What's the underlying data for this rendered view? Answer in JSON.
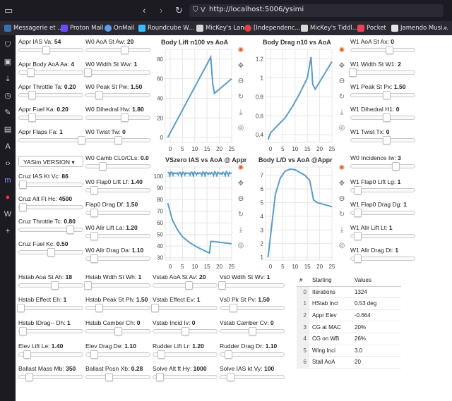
{
  "browser": {
    "url": "http://localhost:5006/ysimi",
    "bookmarks": [
      "Messagerie et ...",
      "Proton Mail",
      "OnMail",
      "Roundcube W...",
      "MicKey's Land",
      "[Independenc...",
      "MicKey's Tiddl...",
      "Pocket",
      "Jamendo Musi..."
    ]
  },
  "controls": {
    "appr_ias": {
      "label": "Appr IAS Va:",
      "value": "54",
      "level": 0.42
    },
    "appr_body_aoa": {
      "label": "Appr Body AoA Aa:",
      "value": "4",
      "level": 0.18
    },
    "appr_throttle": {
      "label": "Appr Throttle Ta:",
      "value": "0.20",
      "level": 0.2
    },
    "appr_fuel": {
      "label": "Appr Fuel Ka:",
      "value": "0.20",
      "level": 0.2
    },
    "appr_flaps": {
      "label": "Appr Flaps Fa:",
      "value": "1",
      "level": 0.98
    },
    "cruz_ias": {
      "label": "Cruz IAS Kt Vc:",
      "value": "86",
      "level": 0.05
    },
    "cruz_alt": {
      "label": "Cruz Alt Ft Hc:",
      "value": "4500",
      "level": 0.05
    },
    "cruz_throttle": {
      "label": "Cruz Throttle Tc:",
      "value": "0.80",
      "level": 0.8
    },
    "cruz_fuel": {
      "label": "Cruz Fuel Kc:",
      "value": "0.50",
      "level": 0.5
    },
    "w0_aoa_st": {
      "label": "W0 AoA St Aw:",
      "value": "20",
      "level": 0.6
    },
    "w0_width_st": {
      "label": "W0 Width St Ww:",
      "value": "1",
      "level": 0.02
    },
    "w0_peak_st": {
      "label": "W0 Peak St Pw:",
      "value": "1.50",
      "level": 0.2
    },
    "w0_dihedral": {
      "label": "W0 Dihedral Hw:",
      "value": "1.80",
      "level": 0.6
    },
    "w0_twist": {
      "label": "W0 Twist Tw:",
      "value": "0",
      "level": 0.5
    },
    "w0_camb": {
      "label": "W0 Camb CL0/CLs:",
      "value": "0.0",
      "level": 0.25
    },
    "w0_flap0_lift": {
      "label": "W0 Flap0 Lift Lf:",
      "value": "1.40",
      "level": 0.12
    },
    "flap0_drag": {
      "label": "Flap0 Drag Df:",
      "value": "1.50",
      "level": 0.12
    },
    "w0_alr_lift": {
      "label": "W0 Allr Lift La:",
      "value": "1.20",
      "level": 0.12
    },
    "w0_alr_drag": {
      "label": "W0 Allr Drag Da:",
      "value": "1.10",
      "level": 0.12
    },
    "w1_aoa_st": {
      "label": "W1 AoA St Ax:",
      "value": "0",
      "level": 0.6
    },
    "w1_width_st": {
      "label": "W1 Width St W1:",
      "value": "2",
      "level": 0.02
    },
    "w1_peak_st": {
      "label": "W1 Peak St Px:",
      "value": "1.50",
      "level": 0.55
    },
    "w1_dihedral": {
      "label": "W1 Dihedral H1:",
      "value": "0",
      "level": 0.55
    },
    "w1_twist": {
      "label": "W1 Twist Tx:",
      "value": "0",
      "level": 0.55
    },
    "w0_incidence": {
      "label": "W0 Incidence Iw:",
      "value": "3",
      "level": 0.7
    },
    "w1_flap0_lift": {
      "label": "W1 Flap0 Lift Lg:",
      "value": "1",
      "level": 0.1
    },
    "w1_flap0_drag": {
      "label": "W1 Flap0 Drag Dg:",
      "value": "1",
      "level": 0.1
    },
    "w1_alr_lift": {
      "label": "W1 Allr Lift Lt:",
      "value": "1",
      "level": 0.1
    },
    "w1_alr_drag": {
      "label": "W1 Allr Drag Dt:",
      "value": "1",
      "level": 0.1
    },
    "hstab_aoa_st": {
      "label": "Hstab Aoa St Ah:",
      "value": "18",
      "level": 0.55
    },
    "hstab_width_st": {
      "label": "Hstab Wdth St Wh:",
      "value": "1",
      "level": 0.02
    },
    "vstab_aoa_st": {
      "label": "Vstab AoA St Av:",
      "value": "20",
      "level": 0.55
    },
    "vs0_wdth_st": {
      "label": "Vs0 Wdth St Wv:",
      "value": "1",
      "level": 0.02
    },
    "hstab_effect": {
      "label": "Hstab Effect Eh:",
      "value": "1",
      "level": 0.02
    },
    "hstab_peak_st": {
      "label": "Hstab Peak St Ph:",
      "value": "1.50",
      "level": 0.2
    },
    "vstab_effect": {
      "label": "Vstab Effect Ev:",
      "value": "1",
      "level": 0.02
    },
    "vs0_pk_st": {
      "label": "Vs0 Pk St Pv:",
      "value": "1.50",
      "level": 0.2
    },
    "hstab_idrag": {
      "label": "Hstab IDrag-- Dh:",
      "value": "1",
      "level": 0.05
    },
    "hstab_camber": {
      "label": "Hstab Camber Ch:",
      "value": "0",
      "level": 0.5
    },
    "vstab_incid": {
      "label": "Vstab Incid Iv:",
      "value": "0",
      "level": 0.5
    },
    "vstab_camber": {
      "label": "Vstab Camber Cv:",
      "value": "0",
      "level": 0.5
    },
    "elev_lift": {
      "label": "Elev Lift Le:",
      "value": "1.40",
      "level": 0.12
    },
    "elev_drag": {
      "label": "Elev Drag De:",
      "value": "1.10",
      "level": 0.12
    },
    "rudder_lift": {
      "label": "Rudder Lift Lr:",
      "value": "1.20",
      "level": 0.12
    },
    "rudder_drag": {
      "label": "Rudder Drag Dr:",
      "value": "1.10",
      "level": 0.12
    },
    "ballast_mass": {
      "label": "Ballast Mass Mb:",
      "value": "350",
      "level": 0.15
    },
    "ballast_posn": {
      "label": "Ballast Posn Xb:",
      "value": "0.28",
      "level": 0.35
    },
    "solve_alt": {
      "label": "Solve Alt ft Hy:",
      "value": "1000",
      "level": 0.1
    },
    "solve_ias": {
      "label": "Solve IAS kt Vy:",
      "value": "100",
      "level": 0.15
    }
  },
  "version_select": "YASim VERSION",
  "table": {
    "headers": [
      "#",
      "Starting",
      "Values"
    ],
    "rows": [
      [
        "0",
        "Iterations",
        "1324"
      ],
      [
        "1",
        "HStab Inci",
        "0.53 deg"
      ],
      [
        "2",
        "Appr Elev",
        "-0.664"
      ],
      [
        "3",
        "CG at MAC",
        "20%"
      ],
      [
        "4",
        "CG on WB",
        "26%"
      ],
      [
        "5",
        "Wing Inci",
        "3.0"
      ],
      [
        "6",
        "Stall AoA",
        "20"
      ]
    ]
  },
  "colors": {
    "line": "#5b9bc8",
    "grid": "#e6e6e6"
  },
  "chart_data": [
    {
      "type": "line",
      "title": "Body Lift n100 vs AoA",
      "xticks": [
        "0",
        "5",
        "10",
        "15",
        "20",
        "25"
      ],
      "yticks": [
        "0",
        "20",
        "40",
        "60",
        "80"
      ],
      "xlim": [
        -2,
        25
      ],
      "ylim": [
        -5,
        90
      ],
      "series": [
        {
          "x": [
            -1,
            16.5,
            17.3,
            18,
            25
          ],
          "y": [
            0,
            82,
            55,
            45,
            60
          ]
        }
      ]
    },
    {
      "type": "line",
      "title": "Body Drag n10 vs AoA",
      "xticks": [
        "0",
        "5",
        "10",
        "15",
        "20",
        "25"
      ],
      "yticks": [
        "0.4",
        "0.6",
        "0.8",
        "1",
        "1.2"
      ],
      "xlim": [
        -2,
        25
      ],
      "ylim": [
        0.32,
        1.3
      ],
      "series": [
        {
          "x": [
            -1,
            0,
            3,
            6,
            9,
            12,
            15,
            16.5,
            17.2,
            18.2,
            25
          ],
          "y": [
            0.35,
            0.42,
            0.5,
            0.58,
            0.7,
            0.84,
            1.0,
            1.22,
            0.93,
            0.88,
            1.17
          ]
        }
      ]
    },
    {
      "type": "line",
      "title": "VSzero IAS vs AoA @ Appr",
      "xticks": [
        "0",
        "5",
        "10",
        "15",
        "20",
        "25"
      ],
      "yticks": [
        "30",
        "40",
        "50",
        "60",
        "70",
        "80",
        "90",
        "100"
      ],
      "xlim": [
        -2,
        25
      ],
      "ylim": [
        28,
        108
      ],
      "series": [
        {
          "x": [
            -1,
            3,
            7,
            11,
            15,
            25
          ],
          "y": [
            102,
            103,
            102,
            103,
            102,
            103
          ]
        },
        {
          "x": [
            -1,
            1,
            3,
            5,
            8,
            11,
            14,
            16,
            16.5,
            17.5,
            25
          ],
          "y": [
            77,
            62,
            54,
            48,
            43,
            39,
            36,
            34,
            44,
            44,
            42
          ]
        }
      ]
    },
    {
      "type": "line",
      "title": "Body L/D vs AoA @Appr",
      "xticks": [
        "0",
        "5",
        "10",
        "15",
        "20",
        "25"
      ],
      "yticks": [
        "1",
        "2",
        "3",
        "4",
        "5",
        "6",
        "7"
      ],
      "xlim": [
        -2,
        25
      ],
      "ylim": [
        0.8,
        7.6
      ],
      "series": [
        {
          "x": [
            -1,
            2,
            4,
            6,
            8,
            10,
            12,
            14,
            16,
            17.5,
            19,
            25
          ],
          "y": [
            1.0,
            5.6,
            6.8,
            7.3,
            7.45,
            7.4,
            7.2,
            7.0,
            6.6,
            5.2,
            5.0,
            4.7
          ]
        }
      ]
    }
  ]
}
